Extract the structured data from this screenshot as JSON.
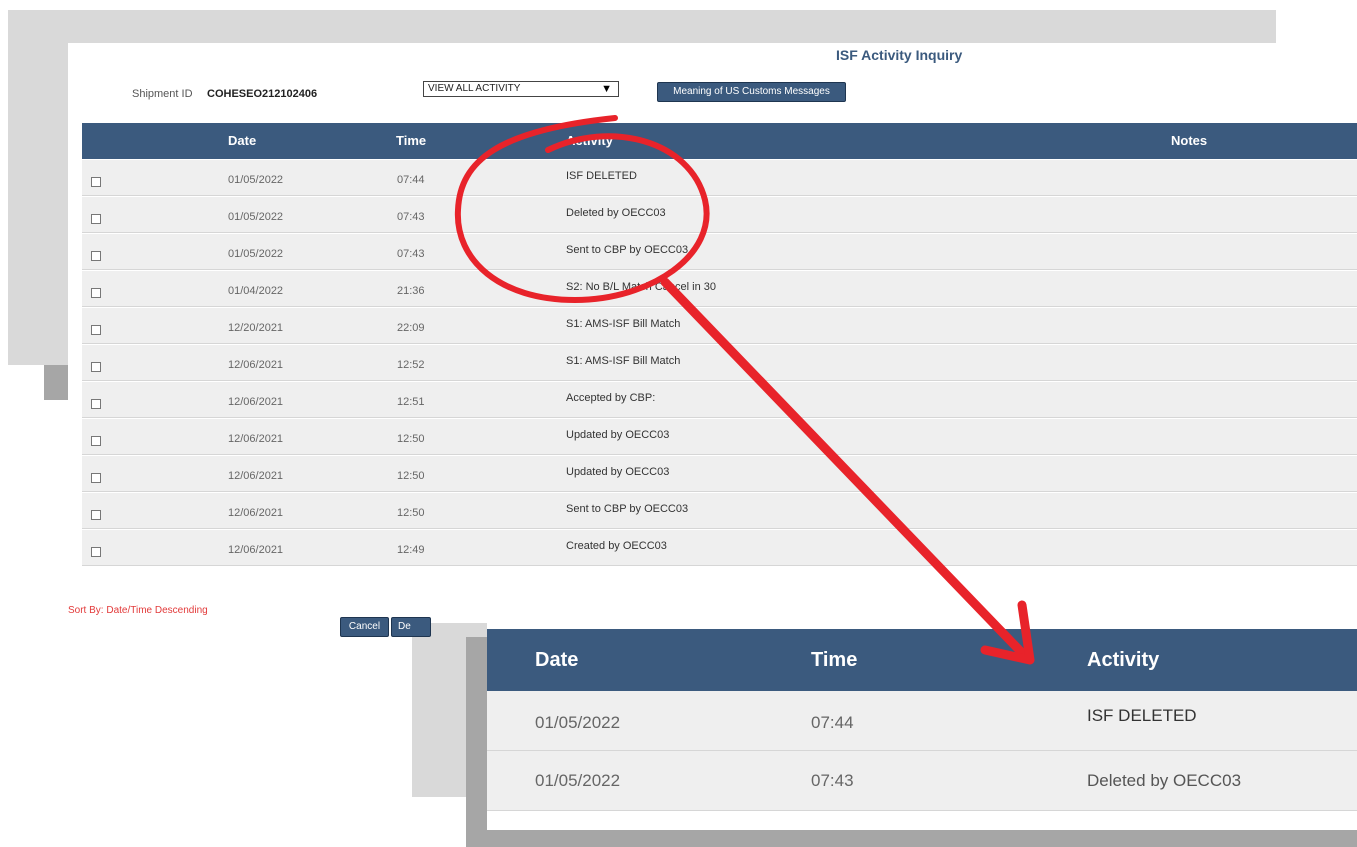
{
  "page": {
    "title": "ISF Activity Inquiry",
    "shipment_label": "Shipment ID",
    "shipment_id": "COHESEO212102406",
    "filter_select": {
      "selected": "VIEW ALL ACTIVITY"
    },
    "meaning_button": "Meaning of US Customs Messages"
  },
  "table": {
    "headers": {
      "date": "Date",
      "time": "Time",
      "activity": "Activity",
      "notes": "Notes"
    },
    "rows": [
      {
        "date": "01/05/2022",
        "time": "07:44",
        "activity": "ISF DELETED"
      },
      {
        "date": "01/05/2022",
        "time": "07:43",
        "activity": "Deleted by OECC03"
      },
      {
        "date": "01/05/2022",
        "time": "07:43",
        "activity": "Sent to CBP by OECC03"
      },
      {
        "date": "01/04/2022",
        "time": "21:36",
        "activity": "S2: No B/L Match Cancel in 30"
      },
      {
        "date": "12/20/2021",
        "time": "22:09",
        "activity": "S1: AMS-ISF Bill Match"
      },
      {
        "date": "12/06/2021",
        "time": "12:52",
        "activity": "S1: AMS-ISF Bill Match"
      },
      {
        "date": "12/06/2021",
        "time": "12:51",
        "activity": "Accepted by CBP:"
      },
      {
        "date": "12/06/2021",
        "time": "12:50",
        "activity": "Updated by OECC03"
      },
      {
        "date": "12/06/2021",
        "time": "12:50",
        "activity": "Updated by OECC03"
      },
      {
        "date": "12/06/2021",
        "time": "12:50",
        "activity": "Sent to CBP by OECC03"
      },
      {
        "date": "12/06/2021",
        "time": "12:49",
        "activity": "Created by OECC03"
      }
    ]
  },
  "footer": {
    "sort_by": "Sort By: Date/Time Descending",
    "cancel_button": "Cancel",
    "second_button_partial": "De"
  },
  "zoom": {
    "headers": {
      "date": "Date",
      "time": "Time",
      "activity": "Activity"
    },
    "rows": [
      {
        "date": "01/05/2022",
        "time": "07:44",
        "activity": "ISF DELETED"
      },
      {
        "date": "01/05/2022",
        "time": "07:43",
        "activity": "Deleted by OECC03"
      }
    ]
  },
  "colors": {
    "header_bg": "#3b5a7e",
    "row_bg": "#efefef",
    "annotation": "#e8232a",
    "sort_text": "#e23a3a"
  }
}
